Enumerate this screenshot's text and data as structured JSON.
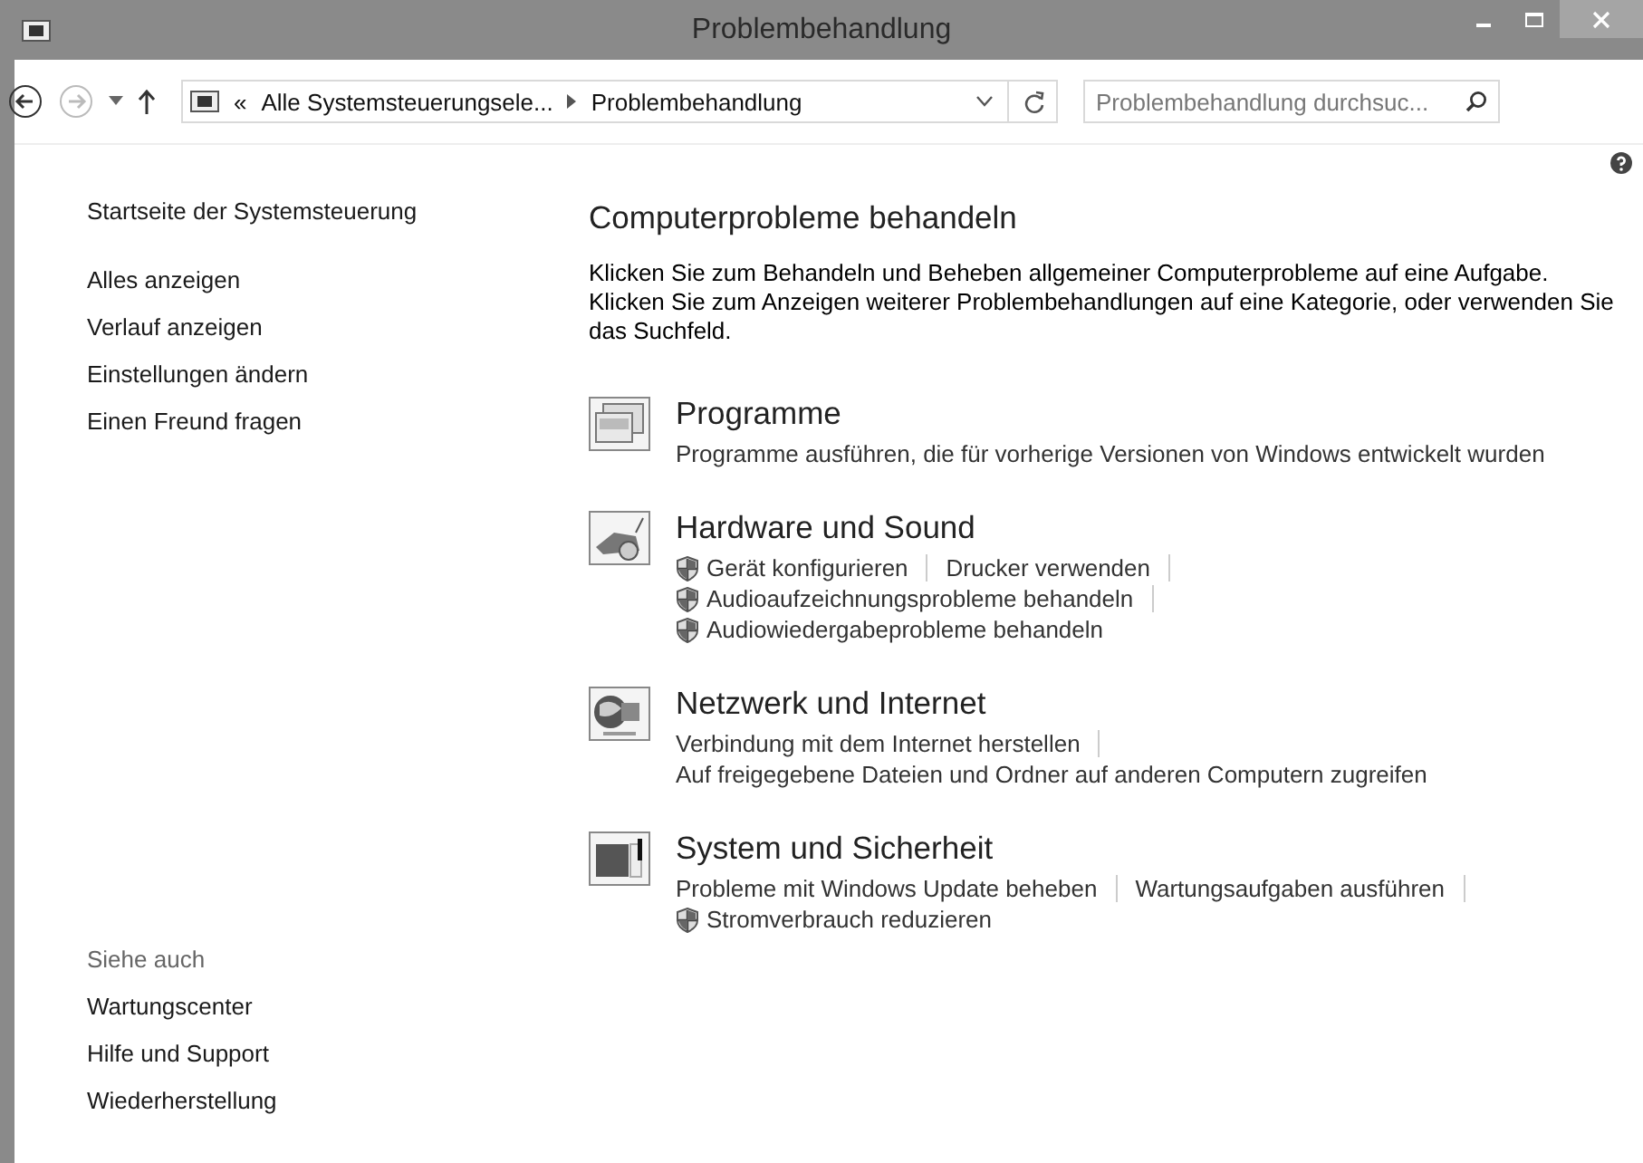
{
  "window": {
    "title": "Problembehandlung"
  },
  "address_bar": {
    "breadcrumbs": [
      "«",
      "Alle Systemsteuerungsele...",
      "Problembehandlung"
    ]
  },
  "search": {
    "placeholder": "Problembehandlung durchsuc..."
  },
  "sidebar": {
    "home": "Startseite der Systemsteuerung",
    "items": [
      "Alles anzeigen",
      "Verlauf anzeigen",
      "Einstellungen ändern",
      "Einen Freund fragen"
    ],
    "see_also": {
      "heading": "Siehe auch",
      "items": [
        "Wartungscenter",
        "Hilfe und Support",
        "Wiederherstellung"
      ]
    }
  },
  "main": {
    "heading": "Computerprobleme behandeln",
    "intro": "Klicken Sie zum Behandeln und Beheben allgemeiner Computerprobleme auf eine Aufgabe. Klicken Sie zum Anzeigen weiterer Problembehandlungen auf eine Kategorie, oder verwenden Sie das Suchfeld.",
    "categories": [
      {
        "kind": "programs",
        "title": "Programme",
        "lines": [
          [
            {
              "label": "Programme ausführen, die für vorherige Versionen von Windows entwickelt wurden",
              "shield": false
            }
          ]
        ]
      },
      {
        "kind": "hardware",
        "title": "Hardware und Sound",
        "lines": [
          [
            {
              "label": "Gerät konfigurieren",
              "shield": true
            },
            {
              "label": "Drucker verwenden",
              "shield": false
            }
          ],
          [
            {
              "label": "Audioaufzeichnungsprobleme behandeln",
              "shield": true
            }
          ],
          [
            {
              "label": "Audiowiedergabeprobleme behandeln",
              "shield": true
            }
          ]
        ]
      },
      {
        "kind": "network",
        "title": "Netzwerk und Internet",
        "lines": [
          [
            {
              "label": "Verbindung mit dem Internet herstellen",
              "shield": false
            }
          ],
          [
            {
              "label": "Auf freigegebene Dateien und Ordner auf anderen Computern zugreifen",
              "shield": false
            }
          ]
        ]
      },
      {
        "kind": "security",
        "title": "System und Sicherheit",
        "lines": [
          [
            {
              "label": "Probleme mit Windows Update beheben",
              "shield": false
            },
            {
              "label": "Wartungsaufgaben ausführen",
              "shield": false
            }
          ],
          [
            {
              "label": "Stromverbrauch reduzieren",
              "shield": true
            }
          ]
        ]
      }
    ]
  }
}
